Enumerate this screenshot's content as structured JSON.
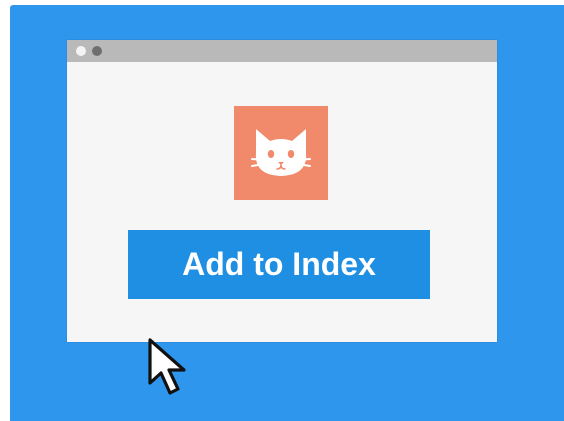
{
  "colors": {
    "backdrop": "#2f96ee",
    "window_bg": "#f6f6f6",
    "titlebar": "#b9b9b9",
    "dot_close": "#f4f4f4",
    "dot_min": "#6f6f6f",
    "logo_bg": "#f08a6a",
    "button_bg": "#1f8fe3",
    "button_text": "#ffffff"
  },
  "window": {
    "titlebar_dots": [
      "close-dot",
      "minimize-dot"
    ]
  },
  "logo": {
    "icon": "cat-face-icon"
  },
  "button": {
    "label": "Add to Index"
  },
  "cursor": {
    "icon": "mouse-pointer-icon"
  }
}
